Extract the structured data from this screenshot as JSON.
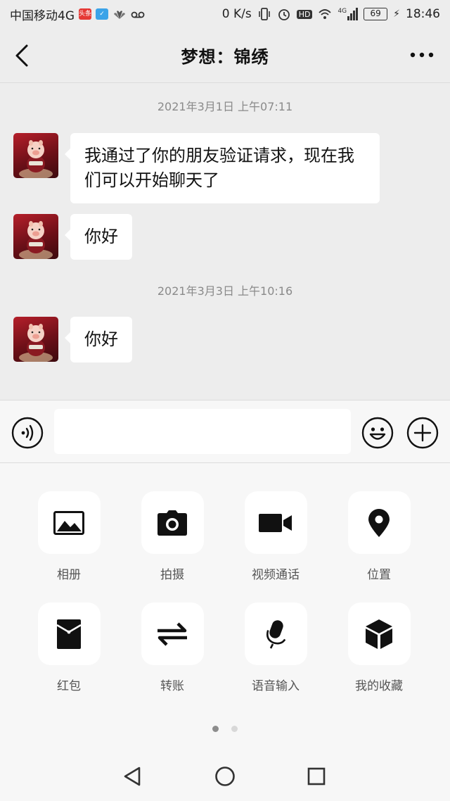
{
  "status_bar": {
    "carrier": "中国移动4G",
    "badge_1": "头条",
    "net_speed": "0 K/s",
    "hd": "HD",
    "sig_4g": "4G",
    "battery": "69",
    "time": "18:46"
  },
  "header": {
    "title": "梦想：锦绣",
    "back_icon": "chevron-left-icon",
    "more_icon": "more-dots-icon"
  },
  "chat": {
    "timestamps": [
      "2021年3月1日 上午07:11",
      "2021年3月3日 上午10:16"
    ],
    "messages": [
      {
        "text": "我通过了你的朋友验证请求，现在我们可以开始聊天了"
      },
      {
        "text": "你好"
      },
      {
        "text": "你好"
      }
    ]
  },
  "input_bar": {
    "voice_icon": "voice-icon",
    "emoji_icon": "emoji-icon",
    "plus_icon": "plus-icon",
    "message_value": ""
  },
  "functions": [
    {
      "label": "相册",
      "icon": "album-icon"
    },
    {
      "label": "拍摄",
      "icon": "camera-icon"
    },
    {
      "label": "视频通话",
      "icon": "video-call-icon"
    },
    {
      "label": "位置",
      "icon": "location-icon"
    },
    {
      "label": "红包",
      "icon": "red-packet-icon"
    },
    {
      "label": "转账",
      "icon": "transfer-icon"
    },
    {
      "label": "语音输入",
      "icon": "microphone-icon"
    },
    {
      "label": "我的收藏",
      "icon": "favorites-icon"
    }
  ],
  "pager": {
    "pages": 2,
    "current": 1
  },
  "colors": {
    "background": "#ededed",
    "panel": "#f7f7f7",
    "bubble": "#ffffff",
    "icon": "#111111"
  }
}
